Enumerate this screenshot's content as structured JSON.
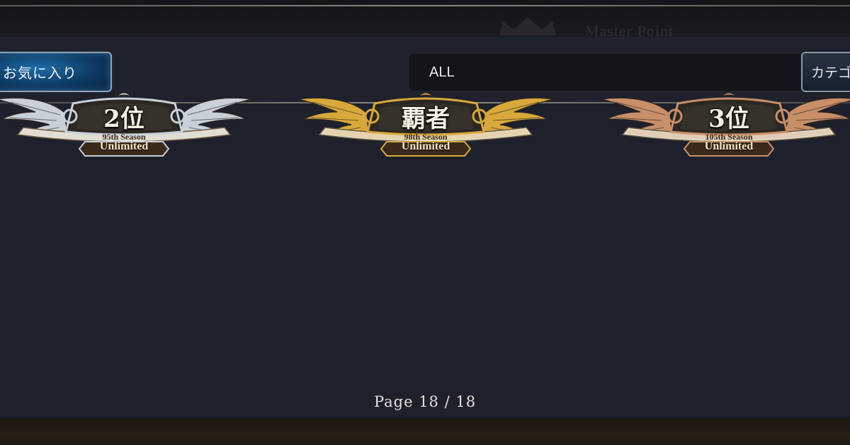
{
  "background_title": "Master Point",
  "toolbar": {
    "favorites_label": "お気に入り",
    "filter_value": "ALL",
    "category_label": "カテゴリ"
  },
  "emblems": [
    {
      "rank": "2位",
      "season": "95th Season",
      "format": "Unlimited",
      "tier": "silver",
      "color": "#c9d0d8"
    },
    {
      "rank": "覇者",
      "season": "98th Season",
      "format": "Unlimited",
      "tier": "gold",
      "color": "#d9a83c"
    },
    {
      "rank": "3位",
      "season": "105th Season",
      "format": "Unlimited",
      "tier": "bronze",
      "color": "#c98f68"
    }
  ],
  "pagination": {
    "text": "Page 18 / 18",
    "current": 18,
    "total": 18
  }
}
